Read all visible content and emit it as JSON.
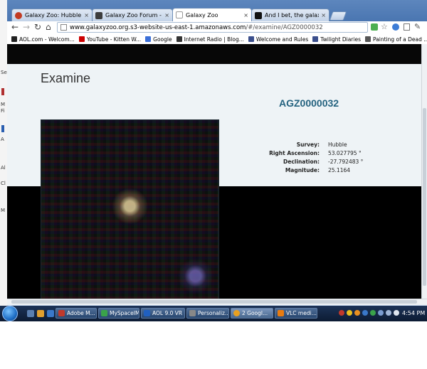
{
  "left_window": {
    "chars": [
      "Sec",
      "M",
      "Fi",
      "A",
      "Al",
      "Cl",
      "M"
    ]
  },
  "browser": {
    "tabs": [
      {
        "label": "Galaxy Zoo: Hubble - How",
        "icon": "galaxy-zoo-icon",
        "active": false
      },
      {
        "label": "Galaxy Zoo Forum - Index",
        "icon": "forum-icon",
        "active": false
      },
      {
        "label": "Galaxy Zoo",
        "icon": "page-icon",
        "active": true
      },
      {
        "label": "And I bet, the galaxies will",
        "icon": "myspace-icon",
        "active": false
      }
    ],
    "tab_close": "×",
    "nav": {
      "back": "←",
      "forward": "→",
      "reload": "↻",
      "home": "⌂"
    },
    "url": {
      "host": "www.galaxyzoo.org.s3-website-us-east-1.amazonaws.com",
      "path": "/#/examine/AGZ0000032"
    },
    "bookmarks": [
      {
        "label": "AOL.com - Welcom...",
        "color": "#222222"
      },
      {
        "label": "YouTube - Kitten W...",
        "color": "#cc0000"
      },
      {
        "label": "Google",
        "color": "#3b6fd8"
      },
      {
        "label": "Internet Radio | Blog...",
        "color": "#333333"
      },
      {
        "label": "Welcome and Rules",
        "color": "#3b4f8c"
      },
      {
        "label": "Twilight Diaries",
        "color": "#3b4f8c"
      },
      {
        "label": "Painting of a Dead ...",
        "color": "#555555"
      }
    ]
  },
  "page": {
    "heading": "Examine",
    "object_id": "AGZ0000032",
    "metadata": [
      {
        "label": "Survey:",
        "value": "Hubble"
      },
      {
        "label": "Right Ascension:",
        "value": "53.027795 °"
      },
      {
        "label": "Declination:",
        "value": "-27.792483 °"
      },
      {
        "label": "Magnitude:",
        "value": "25.1164"
      }
    ]
  },
  "taskbar": {
    "tasks": [
      {
        "label": "Adobe M...",
        "color": "#c0392b",
        "active": false
      },
      {
        "label": "MySpaceIM",
        "color": "#3aa34a",
        "active": false
      },
      {
        "label": "AOL 9.0 VR",
        "color": "#2060c0",
        "active": false
      },
      {
        "label": "Personaliz...",
        "color": "#888888",
        "active": false
      },
      {
        "label": "2 Googl...",
        "color": "#e8a020",
        "active": true
      },
      {
        "label": "VLC medi...",
        "color": "#e87b10",
        "active": false
      }
    ],
    "clock": "4:54 PM"
  }
}
